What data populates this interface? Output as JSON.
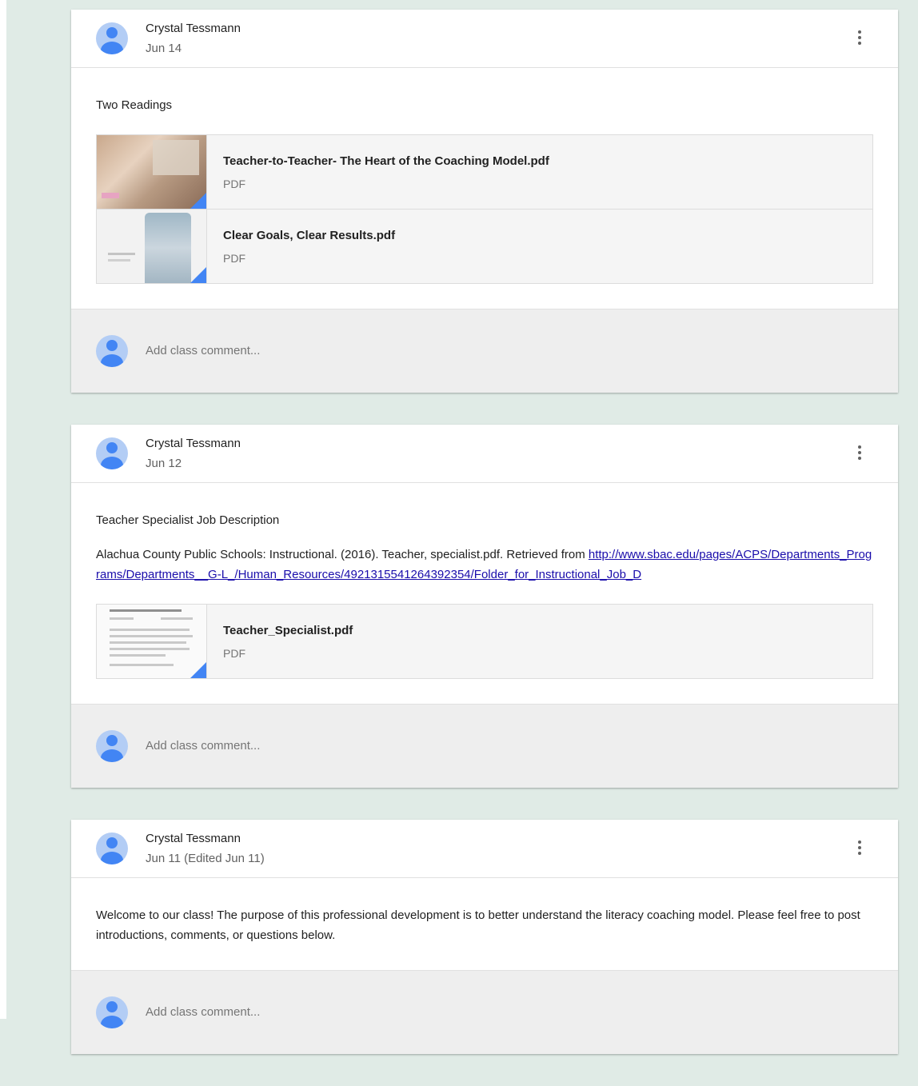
{
  "posts": [
    {
      "author": "Crystal Tessmann",
      "date": "Jun 14",
      "text": "Two Readings",
      "attachments": [
        {
          "title": "Teacher-to-Teacher- The Heart of the Coaching Model.pdf",
          "type": "PDF"
        },
        {
          "title": "Clear Goals, Clear Results.pdf",
          "type": "PDF"
        }
      ],
      "comment_placeholder": "Add class comment..."
    },
    {
      "author": "Crystal Tessmann",
      "date": "Jun 12",
      "text": "Teacher Specialist Job Description",
      "citation_prefix": "Alachua County Public Schools: Instructional. (2016). Teacher, specialist.pdf. Retrieved from ",
      "citation_link": "http://www.sbac.edu/pages/ACPS/Departments_Programs/Departments__G-L_/Human_Resources/4921315541264392354/Folder_for_Instructional_Job_D",
      "attachments": [
        {
          "title": "Teacher_Specialist.pdf",
          "type": "PDF"
        }
      ],
      "comment_placeholder": "Add class comment..."
    },
    {
      "author": "Crystal Tessmann",
      "date": "Jun 11 (Edited Jun 11)",
      "text": "Welcome to our class! The purpose of this professional development is to better understand the literacy coaching model. Please feel free to post introductions, comments, or questions below.",
      "comment_placeholder": "Add class comment..."
    }
  ],
  "icons": {
    "avatar": "person-avatar-icon",
    "more": "more-vert-icon",
    "attachment_corner": "google-drive-corner-icon"
  },
  "colors": {
    "background": "#e0ebe6",
    "avatar_blue": "#4285f4",
    "link": "#1a0dab",
    "comment_area": "#eeeeee"
  }
}
